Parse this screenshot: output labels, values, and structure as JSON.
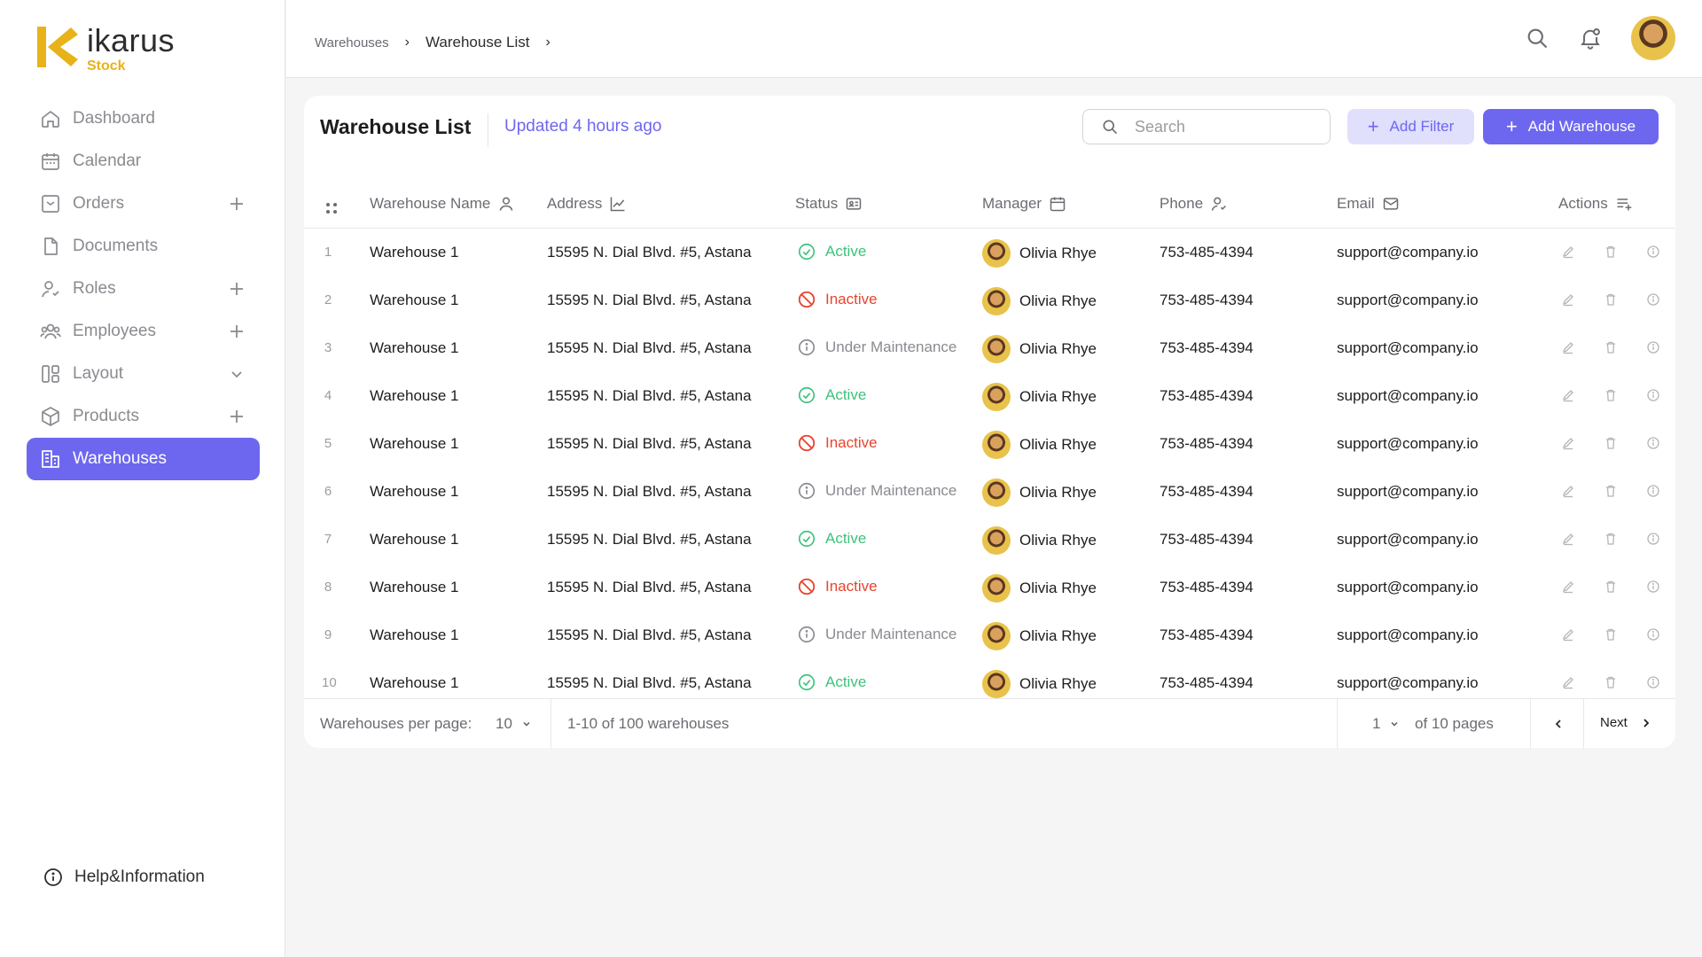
{
  "brand": {
    "name": "ikarus",
    "sub": "Stock",
    "accent": "#6d67ef",
    "yellow": "#e8b21a"
  },
  "sidebar": {
    "items": [
      {
        "label": "Dashboard",
        "icon": "home-icon",
        "trail": ""
      },
      {
        "label": "Calendar",
        "icon": "calendar-icon",
        "trail": ""
      },
      {
        "label": "Orders",
        "icon": "orders-icon",
        "trail": "plus"
      },
      {
        "label": "Documents",
        "icon": "document-icon",
        "trail": ""
      },
      {
        "label": "Roles",
        "icon": "roles-icon",
        "trail": "plus"
      },
      {
        "label": "Employees",
        "icon": "employees-icon",
        "trail": "plus"
      },
      {
        "label": "Layout",
        "icon": "layout-icon",
        "trail": "chevron"
      },
      {
        "label": "Products",
        "icon": "box-icon",
        "trail": "plus"
      },
      {
        "label": "Warehouses",
        "icon": "building-icon",
        "trail": "",
        "active": true
      }
    ],
    "help_label": "Help&Information"
  },
  "breadcrumb": {
    "parent": "Warehouses",
    "current": "Warehouse List"
  },
  "header": {
    "title": "Warehouse List",
    "updated": "Updated 4 hours ago",
    "search_placeholder": "Search",
    "add_filter": "Add Filter",
    "add_warehouse": "Add Warehouse"
  },
  "table": {
    "columns": {
      "name": "Warehouse Name",
      "address": "Address",
      "status": "Status",
      "manager": "Manager",
      "phone": "Phone",
      "email": "Email",
      "actions": "Actions"
    },
    "rows": [
      {
        "idx": "1",
        "name": "Warehouse 1",
        "address": "15595 N. Dial Blvd. #5, Astana",
        "status": "Active",
        "manager": "Olivia Rhye",
        "phone": "753-485-4394",
        "email": "support@company.io"
      },
      {
        "idx": "2",
        "name": "Warehouse 1",
        "address": "15595 N. Dial Blvd. #5, Astana",
        "status": "Inactive",
        "manager": "Olivia Rhye",
        "phone": "753-485-4394",
        "email": "support@company.io"
      },
      {
        "idx": "3",
        "name": "Warehouse 1",
        "address": "15595 N. Dial Blvd. #5, Astana",
        "status": "Under Maintenance",
        "manager": "Olivia Rhye",
        "phone": "753-485-4394",
        "email": "support@company.io"
      },
      {
        "idx": "4",
        "name": "Warehouse 1",
        "address": "15595 N. Dial Blvd. #5, Astana",
        "status": "Active",
        "manager": "Olivia Rhye",
        "phone": "753-485-4394",
        "email": "support@company.io"
      },
      {
        "idx": "5",
        "name": "Warehouse 1",
        "address": "15595 N. Dial Blvd. #5, Astana",
        "status": "Inactive",
        "manager": "Olivia Rhye",
        "phone": "753-485-4394",
        "email": "support@company.io"
      },
      {
        "idx": "6",
        "name": "Warehouse 1",
        "address": "15595 N. Dial Blvd. #5, Astana",
        "status": "Under Maintenance",
        "manager": "Olivia Rhye",
        "phone": "753-485-4394",
        "email": "support@company.io"
      },
      {
        "idx": "7",
        "name": "Warehouse 1",
        "address": "15595 N. Dial Blvd. #5, Astana",
        "status": "Active",
        "manager": "Olivia Rhye",
        "phone": "753-485-4394",
        "email": "support@company.io"
      },
      {
        "idx": "8",
        "name": "Warehouse 1",
        "address": "15595 N. Dial Blvd. #5, Astana",
        "status": "Inactive",
        "manager": "Olivia Rhye",
        "phone": "753-485-4394",
        "email": "support@company.io"
      },
      {
        "idx": "9",
        "name": "Warehouse 1",
        "address": "15595 N. Dial Blvd. #5, Astana",
        "status": "Under Maintenance",
        "manager": "Olivia Rhye",
        "phone": "753-485-4394",
        "email": "support@company.io"
      },
      {
        "idx": "10",
        "name": "Warehouse 1",
        "address": "15595 N. Dial Blvd. #5, Astana",
        "status": "Active",
        "manager": "Olivia Rhye",
        "phone": "753-485-4394",
        "email": "support@company.io"
      }
    ],
    "status_colors": {
      "Active": "#3cc37a",
      "Inactive": "#e8442e",
      "Under Maintenance": "#8a8a90"
    }
  },
  "footer": {
    "per_page_label": "Warehouses per page:",
    "per_page_value": "10",
    "range": "1-10 of 100 warehouses",
    "page_value": "1",
    "of_pages": "of 10 pages",
    "next": "Next"
  }
}
